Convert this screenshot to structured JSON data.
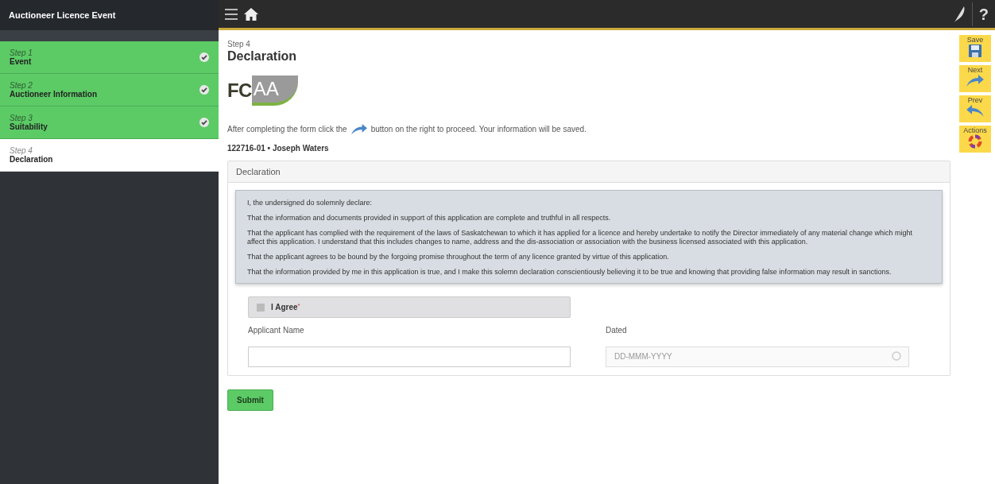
{
  "app_title": "Auctioneer Licence Event",
  "steps": [
    {
      "step": "Step 1",
      "name": "Event",
      "completed": true,
      "selected": false
    },
    {
      "step": "Step 2",
      "name": "Auctioneer Information",
      "completed": true,
      "selected": false
    },
    {
      "step": "Step 3",
      "name": "Suitability",
      "completed": true,
      "selected": false
    },
    {
      "step": "Step 4",
      "name": "Declaration",
      "completed": false,
      "selected": true
    }
  ],
  "top_bar": {
    "help": "?"
  },
  "toolbar": [
    {
      "label": "Save",
      "kind": "save"
    },
    {
      "label": "Next",
      "kind": "next"
    },
    {
      "label": "Prev",
      "kind": "prev"
    },
    {
      "label": "Actions",
      "kind": "actions"
    }
  ],
  "page": {
    "step": "Step 4",
    "title": "Declaration",
    "logo": {
      "dark": "FC",
      "light": "AA"
    },
    "instruction_before": "After completing the form click the",
    "instruction_after": "button on the right to proceed. Your information will be saved.",
    "record": "122716-01 • Joseph Waters"
  },
  "panel": {
    "title": "Declaration",
    "paragraphs": [
      "I, the undersigned do solemnly declare:",
      "That the information and documents provided in support of this application are complete and truthful in all respects.",
      "That the applicant has complied with the requirement of the laws of Saskatchewan to which it has applied for a licence and hereby undertake to notify the Director immediately of any material change which might affect this application. I understand that this includes changes to name, address and the dis-association or association with the business licensed associated with this application.",
      "That the applicant agrees to be bound by the forgoing promise throughout the term of any licence granted by virtue of this application.",
      "That the information provided by me in this application is true, and I make this solemn declaration conscientiously believing it to be true and knowing that providing false information may result in sanctions."
    ],
    "agree": {
      "label": "I Agree",
      "required_mark": "*",
      "checked": false
    },
    "fields": [
      {
        "label": "Applicant Name",
        "kind": "text"
      },
      {
        "label": "Dated",
        "kind": "date",
        "placeholder": "DD-MMM-YYYY"
      }
    ]
  },
  "submit": "Submit"
}
